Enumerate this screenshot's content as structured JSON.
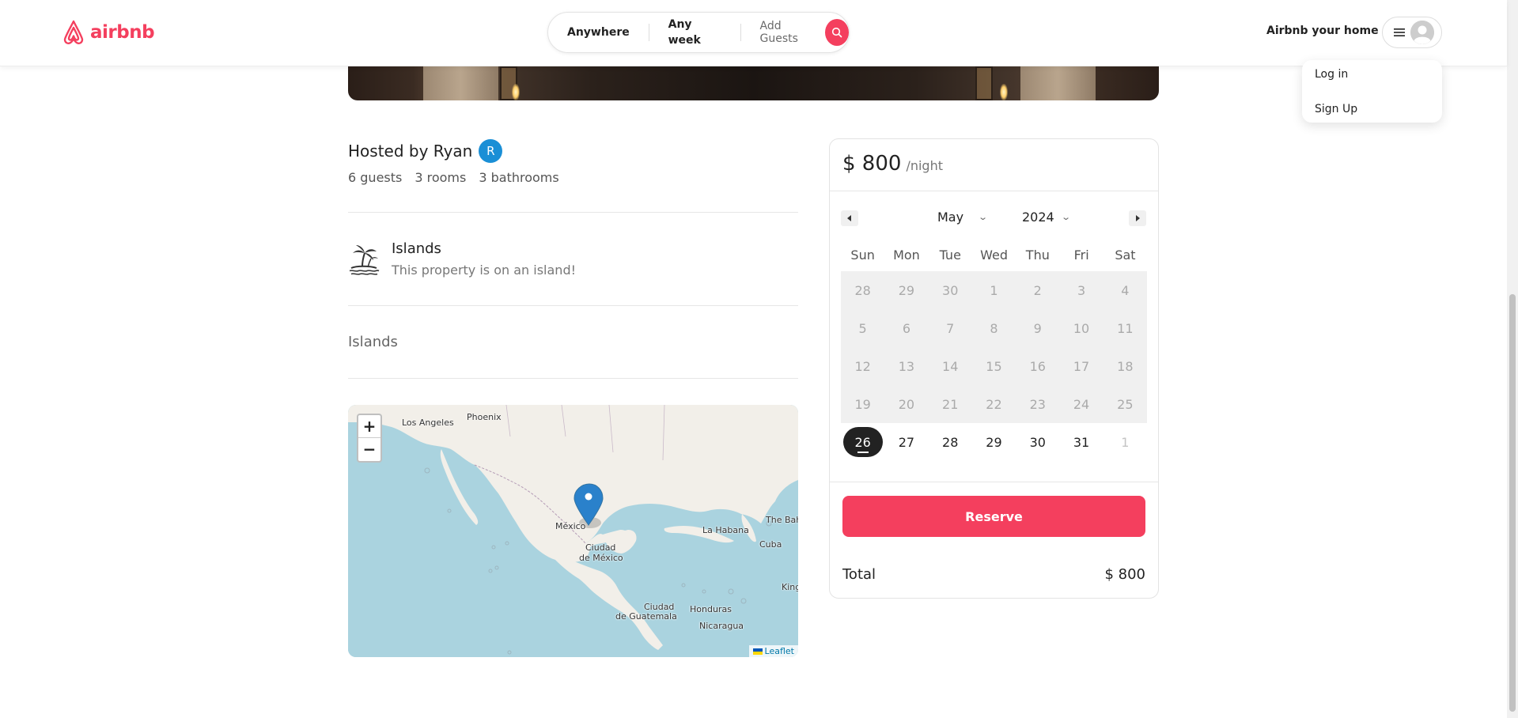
{
  "header": {
    "logo_text": "airbnb",
    "search": {
      "where": "Anywhere",
      "when": "Any week",
      "guests": "Add Guests"
    },
    "host_link": "Airbnb your home",
    "menu": {
      "login": "Log in",
      "signup": "Sign Up"
    }
  },
  "listing": {
    "hosted_by": "Hosted by Ryan",
    "host_initial": "R",
    "stats": [
      "6 guests",
      "3 rooms",
      "3 bathrooms"
    ],
    "category": {
      "title": "Islands",
      "description": "This property is on an island!",
      "icon": "island-palm-icon"
    },
    "description": "Islands"
  },
  "map": {
    "labels": [
      "Los Angeles",
      "Phoenix",
      "México",
      "Ciudad",
      "de México",
      "La Habana",
      "The Bah",
      "Cuba",
      "King",
      "Honduras",
      "Ciudad",
      "de Guatemala",
      "Nicaragua"
    ],
    "attribution": "Leaflet",
    "zoom_in": "+",
    "zoom_out": "−"
  },
  "booking": {
    "price": "$ 800",
    "per_night": "/night",
    "month": "May",
    "year": "2024",
    "weekdays": [
      "Sun",
      "Mon",
      "Tue",
      "Wed",
      "Thu",
      "Fri",
      "Sat"
    ],
    "weeks": [
      [
        "28",
        "29",
        "30",
        "1",
        "2",
        "3",
        "4"
      ],
      [
        "5",
        "6",
        "7",
        "8",
        "9",
        "10",
        "11"
      ],
      [
        "12",
        "13",
        "14",
        "15",
        "16",
        "17",
        "18"
      ],
      [
        "19",
        "20",
        "21",
        "22",
        "23",
        "24",
        "25"
      ],
      [
        "26",
        "27",
        "28",
        "29",
        "30",
        "31",
        "1"
      ]
    ],
    "reserve_label": "Reserve",
    "total_label": "Total",
    "total_value": "$ 800"
  },
  "colors": {
    "brand": "#f43f5e",
    "host_badge": "#1a8fd6",
    "map_water": "#aad3df",
    "map_land": "#f2efe9",
    "marker": "#2a81cb"
  }
}
